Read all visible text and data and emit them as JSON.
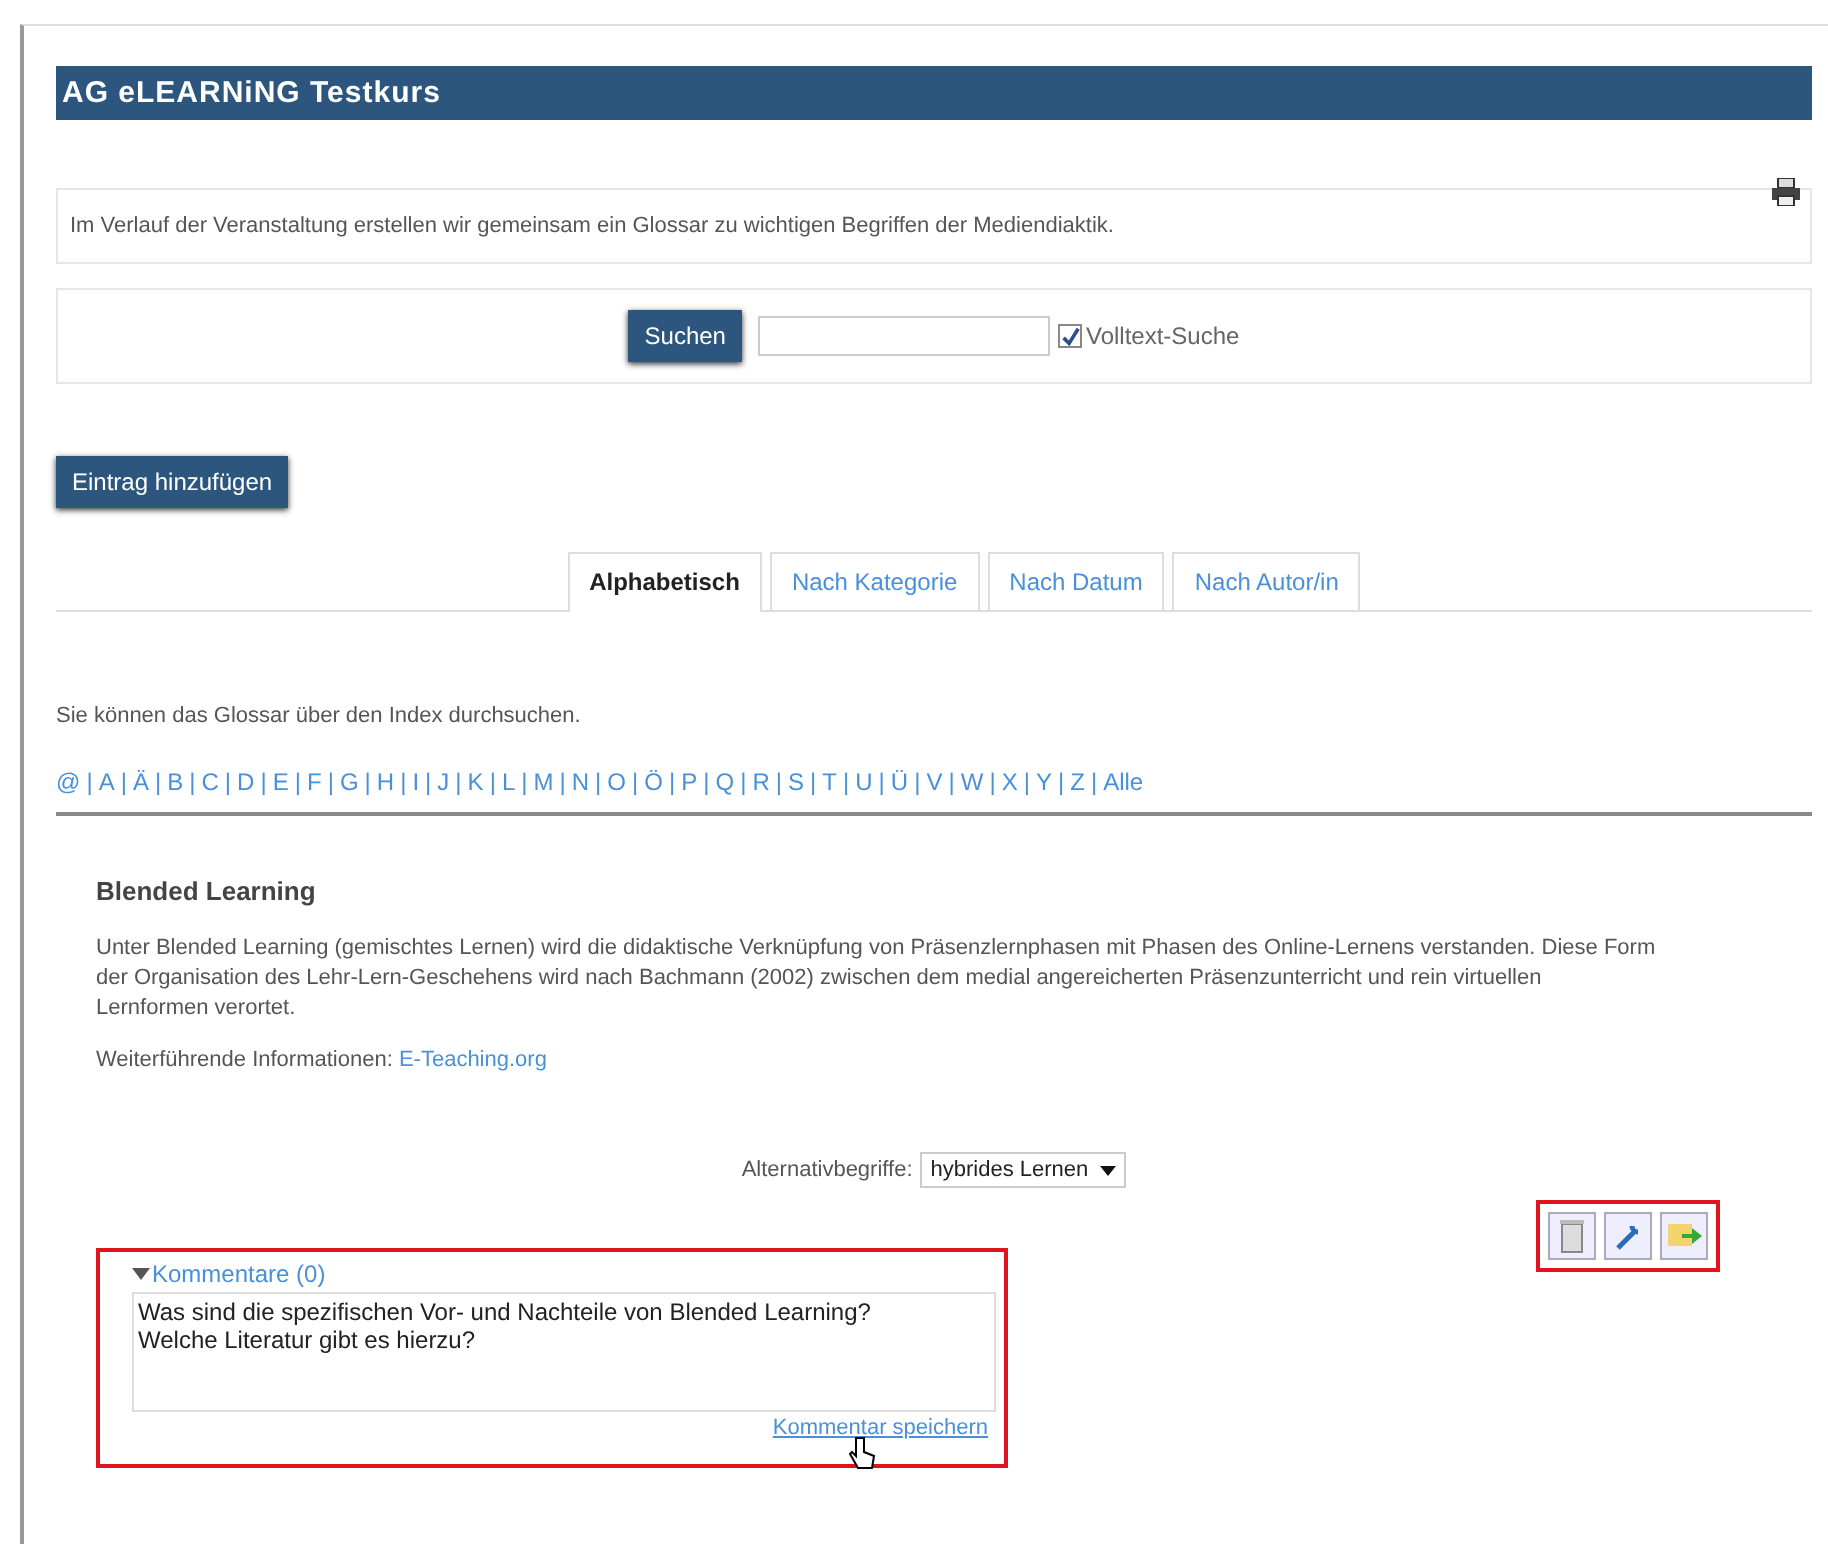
{
  "course_title": "AG eLEARNiNG Testkurs",
  "intro": "Im Verlauf der Veranstaltung erstellen wir gemeinsam ein Glossar zu wichtigen Begriffen der Mediendiaktik.",
  "search": {
    "button": "Suchen",
    "fulltext_checked": true,
    "fulltext_label": "Volltext-Suche"
  },
  "add_button": "Eintrag hinzufügen",
  "tabs": [
    {
      "label": "Alphabetisch",
      "selected": true
    },
    {
      "label": "Nach Kategorie",
      "selected": false
    },
    {
      "label": "Nach Datum",
      "selected": false
    },
    {
      "label": "Nach Autor/in",
      "selected": false
    }
  ],
  "index_hint": "Sie können das Glossar über den Index durchsuchen.",
  "index_separator": "|",
  "index_letters": [
    "@",
    "A",
    "Ä",
    "B",
    "C",
    "D",
    "E",
    "F",
    "G",
    "H",
    "I",
    "J",
    "K",
    "L",
    "M",
    "N",
    "O",
    "Ö",
    "P",
    "Q",
    "R",
    "S",
    "T",
    "U",
    "Ü",
    "V",
    "W",
    "X",
    "Y",
    "Z",
    "Alle"
  ],
  "entry": {
    "title": "Blended Learning",
    "text": "Unter Blended Learning (gemischtes Lernen) wird die didaktische Verknüpfung von Präsenzlernphasen mit Phasen des Online-Lernens verstanden. Diese Form der Organisation des Lehr-Lern-Geschehens wird nach Bachmann (2002) zwischen dem medial angereicherten Präsenzunterricht und rein virtuellen Lernformen verortet.",
    "more_label": "Weiterführende Informationen:",
    "more_link": "E-Teaching.org",
    "alias_label": "Alternativbegriffe:",
    "alias_value": "hybrides Lernen"
  },
  "comments": {
    "toggle": "Kommentare (0)",
    "expanded": true,
    "text": "Was sind die spezifischen Vor- und Nachteile von Blended Learning?\nWelche Literatur gibt es hierzu?",
    "save": "Kommentar speichern"
  }
}
